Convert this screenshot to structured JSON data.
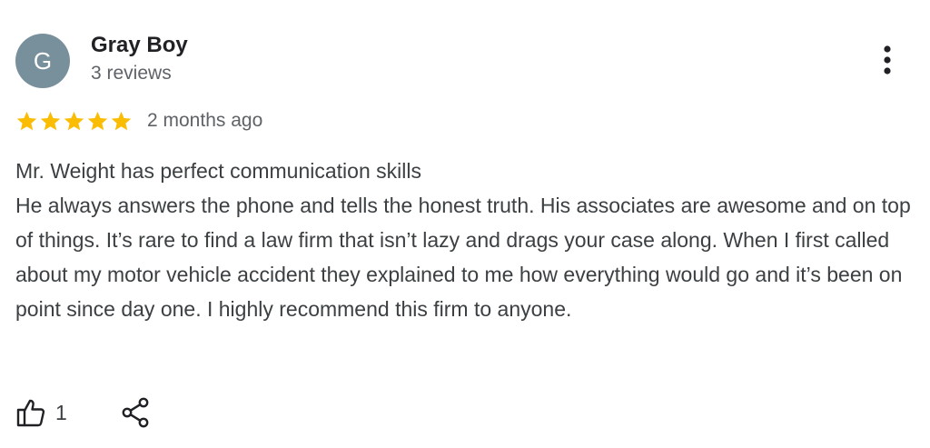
{
  "review": {
    "author": {
      "initial": "G",
      "name": "Gray Boy",
      "review_count": "3 reviews",
      "avatar_color": "#78909c"
    },
    "rating": {
      "stars": 5,
      "max_stars": 5,
      "star_color": "#fbbc04"
    },
    "date": "2 months ago",
    "text": {
      "line1": "Mr. Weight has perfect communication skills",
      "paragraph": "He always answers the phone and tells the honest truth. His associates are awesome and on top of things. It’s rare to find a law firm that isn’t lazy and drags your case along. When I first called about my motor vehicle accident they explained to me how everything would go and it’s been on point since day one. I highly recommend this firm to anyone."
    },
    "actions": {
      "like_icon": "thumbs-up-icon",
      "like_count": "1",
      "share_icon": "share-icon",
      "more_icon": "more-vert-icon"
    }
  }
}
